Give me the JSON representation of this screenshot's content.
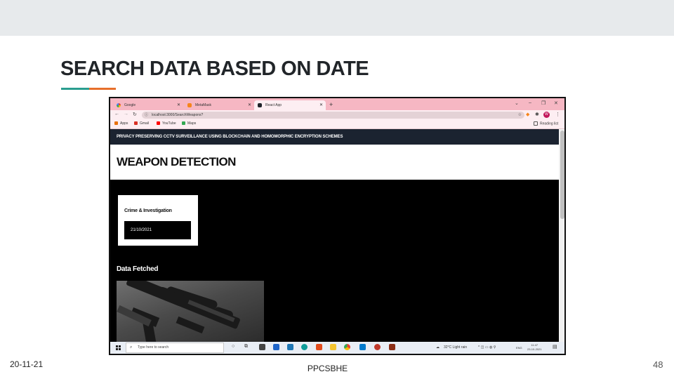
{
  "slide": {
    "title": "SEARCH DATA BASED ON DATE",
    "footer_date": "20-11-21",
    "footer_center": "PPCSBHE",
    "page_number": "48",
    "accent_colors": [
      "#2a9d8f",
      "#e76f2b"
    ]
  },
  "browser": {
    "tabs": [
      {
        "label": "Google",
        "icon": "google-icon"
      },
      {
        "label": "MetaMask",
        "icon": "metamask-icon"
      },
      {
        "label": "React App",
        "icon": "react-icon"
      }
    ],
    "url": "localhost:3000/SearchWeapons?",
    "bookmarks": [
      "Apps",
      "Gmail",
      "YouTube",
      "Maps"
    ],
    "reading_list": "Reading list",
    "profile_initial": "W"
  },
  "app": {
    "navbar_title": "PRIVACY PRESERVING CCTV SURVEILLANCE USING BLOCKCHAIN AND HOMOMORPHIC ENCRYPTION SCHEMES",
    "hero_title": "WEAPON DETECTION",
    "card_label": "Crime & Investigation",
    "date_value": "21/10/2021",
    "section_title": "Data Fetched"
  },
  "taskbar": {
    "search_placeholder": "Type here to search",
    "weather": "32°C Light rain",
    "language": "ENG",
    "time": "11:47",
    "date": "23-10-2021"
  }
}
